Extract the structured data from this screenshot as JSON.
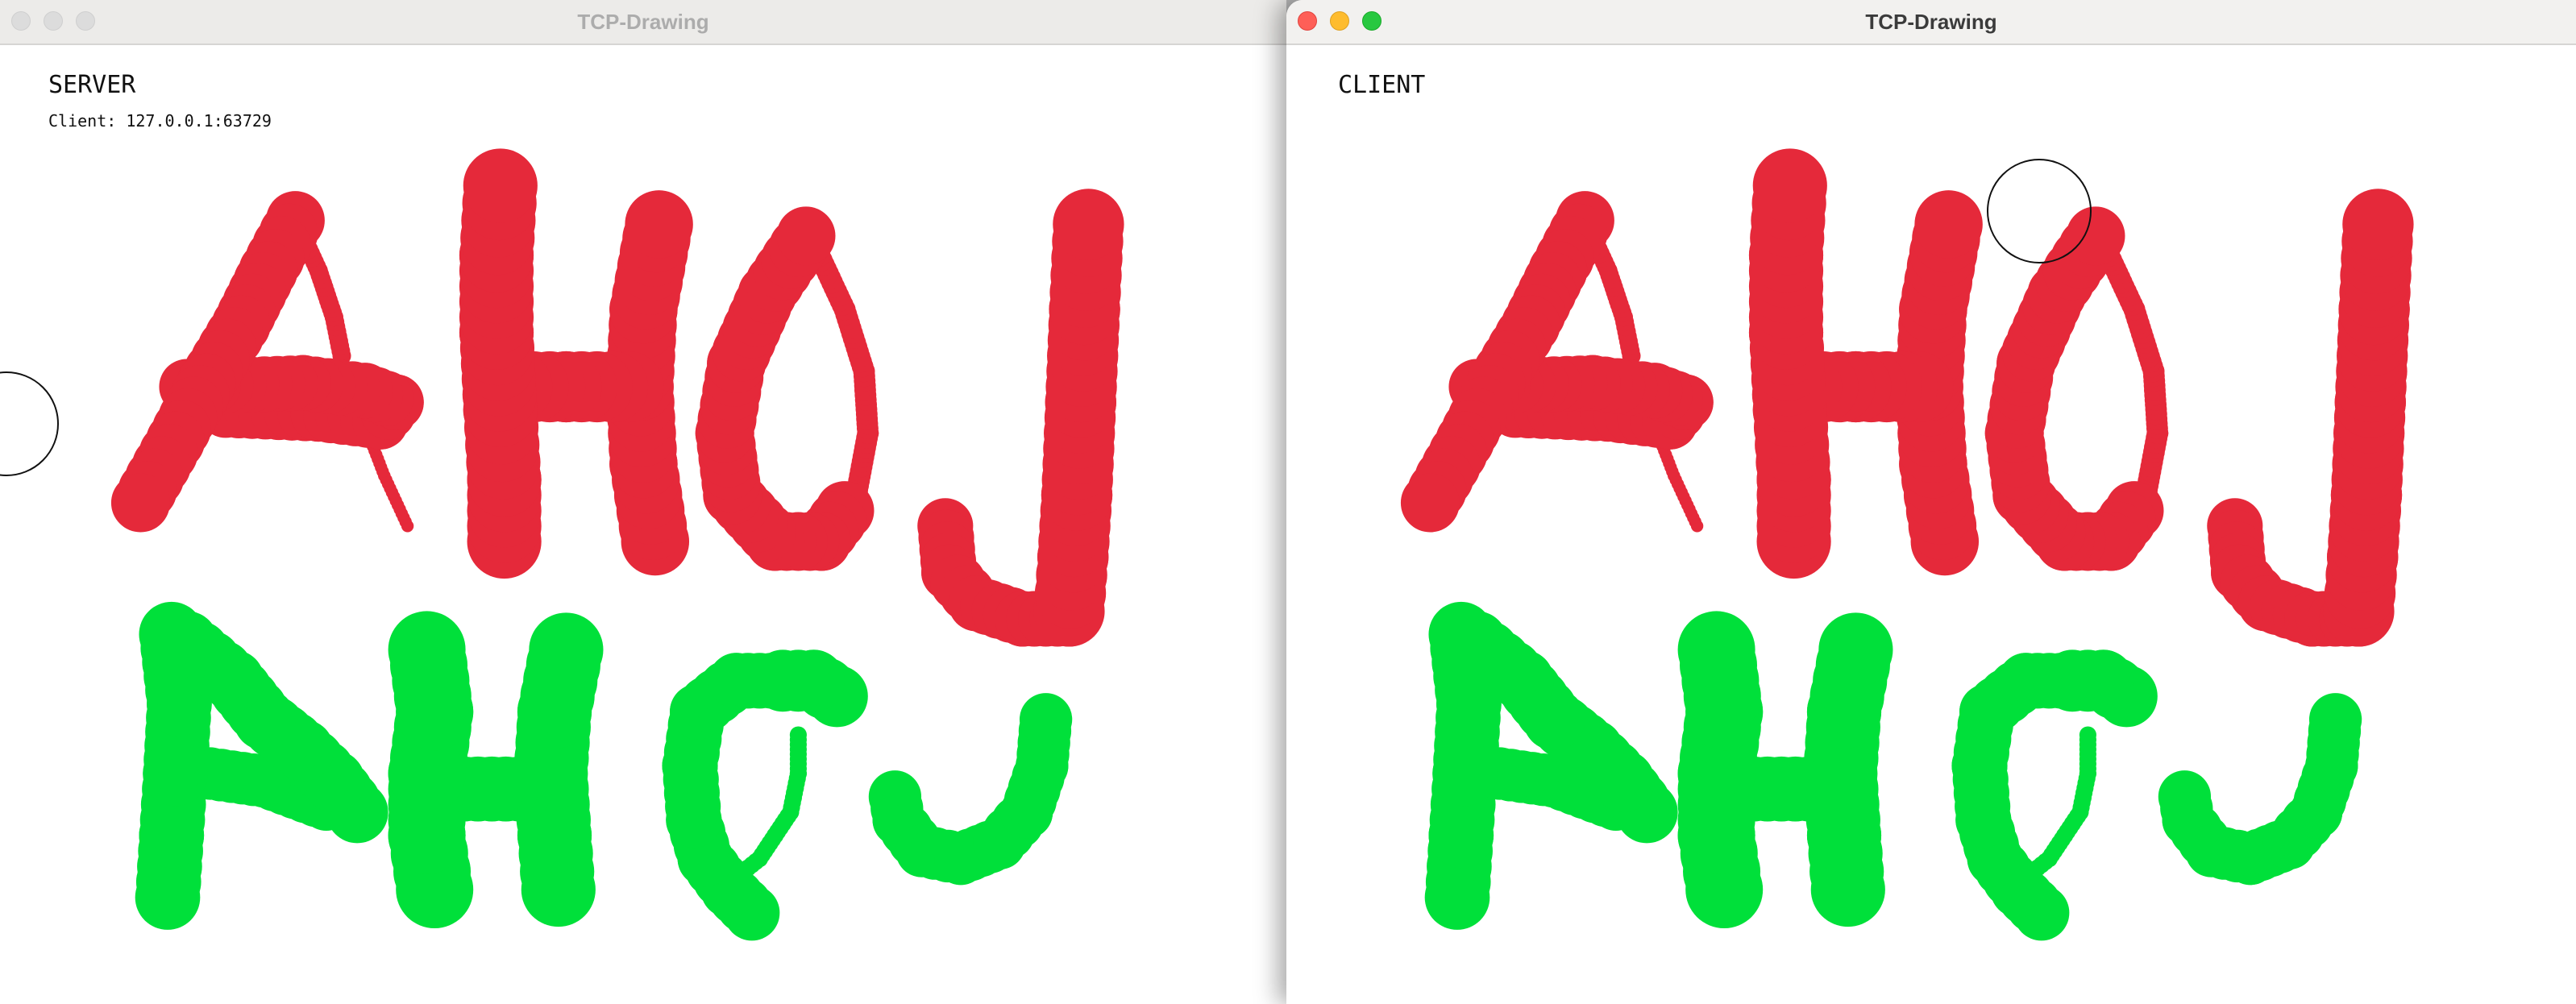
{
  "windows": [
    {
      "id": "server",
      "title": "TCP-Drawing",
      "active": false,
      "role_label": "SERVER",
      "info_line": "Client: 127.0.0.1:63729"
    },
    {
      "id": "client",
      "title": "TCP-Drawing",
      "active": true,
      "role_label": "CLIENT"
    }
  ],
  "drawing": {
    "strokes": [
      {
        "color": "#e5293a",
        "text": "AHOJ"
      },
      {
        "color": "#00e03a",
        "text": "AHOJ"
      }
    ]
  }
}
